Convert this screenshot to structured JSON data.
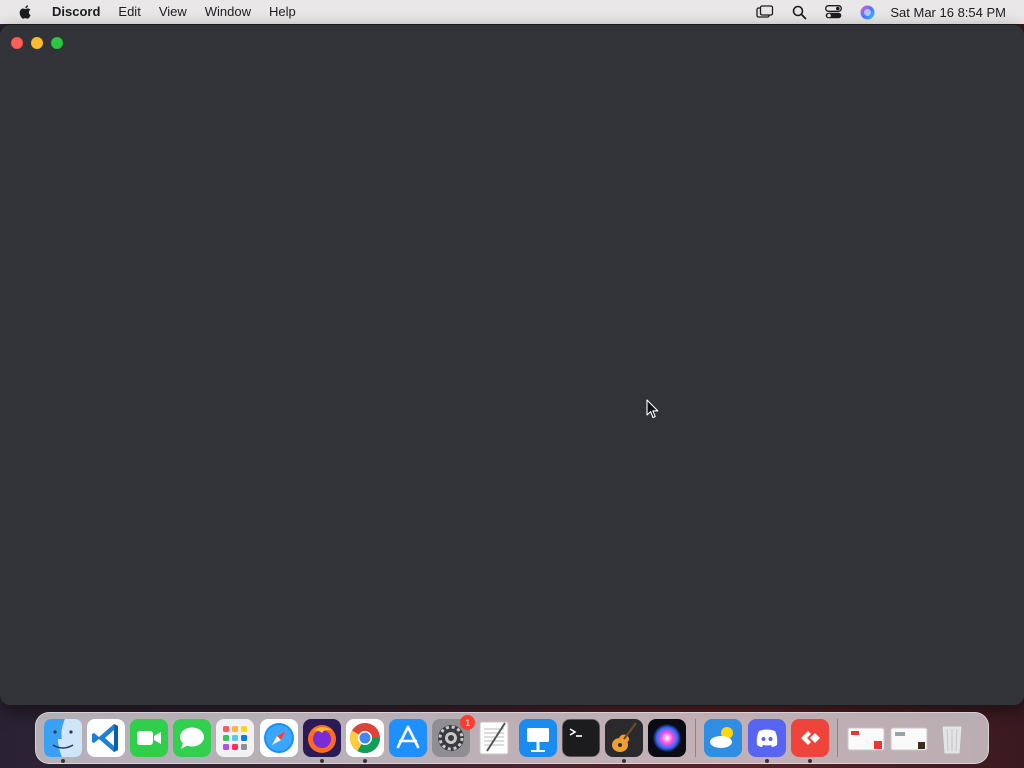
{
  "menubar": {
    "app_name": "Discord",
    "items": [
      "Edit",
      "View",
      "Window",
      "Help"
    ],
    "clock": "Sat Mar 16  8:54 PM",
    "status_icons": [
      "screen-mirroring-icon",
      "spotlight-search-icon",
      "control-center-icon",
      "siri-icon"
    ]
  },
  "window": {
    "app": "Discord",
    "background": "#313338"
  },
  "dock": {
    "apps": [
      {
        "name": "Finder",
        "running": true
      },
      {
        "name": "Visual Studio Code",
        "running": false
      },
      {
        "name": "FaceTime",
        "running": false
      },
      {
        "name": "Messages",
        "running": false
      },
      {
        "name": "Launchpad",
        "running": false
      },
      {
        "name": "Safari",
        "running": false
      },
      {
        "name": "Firefox",
        "running": true
      },
      {
        "name": "Google Chrome",
        "running": true
      },
      {
        "name": "App Store",
        "running": false
      },
      {
        "name": "System Settings",
        "running": false,
        "badge": "1"
      },
      {
        "name": "TextEdit",
        "running": false
      },
      {
        "name": "Keynote",
        "running": false
      },
      {
        "name": "Terminal",
        "running": false
      },
      {
        "name": "GarageBand",
        "running": true
      },
      {
        "name": "Siri",
        "running": false
      },
      {
        "name": "Weather",
        "running": false
      },
      {
        "name": "Discord",
        "running": true
      },
      {
        "name": "AnyDesk",
        "running": true
      },
      {
        "name": "Recent Document 1",
        "running": false
      },
      {
        "name": "Recent Document 2",
        "running": false
      },
      {
        "name": "Trash",
        "running": false
      }
    ]
  }
}
